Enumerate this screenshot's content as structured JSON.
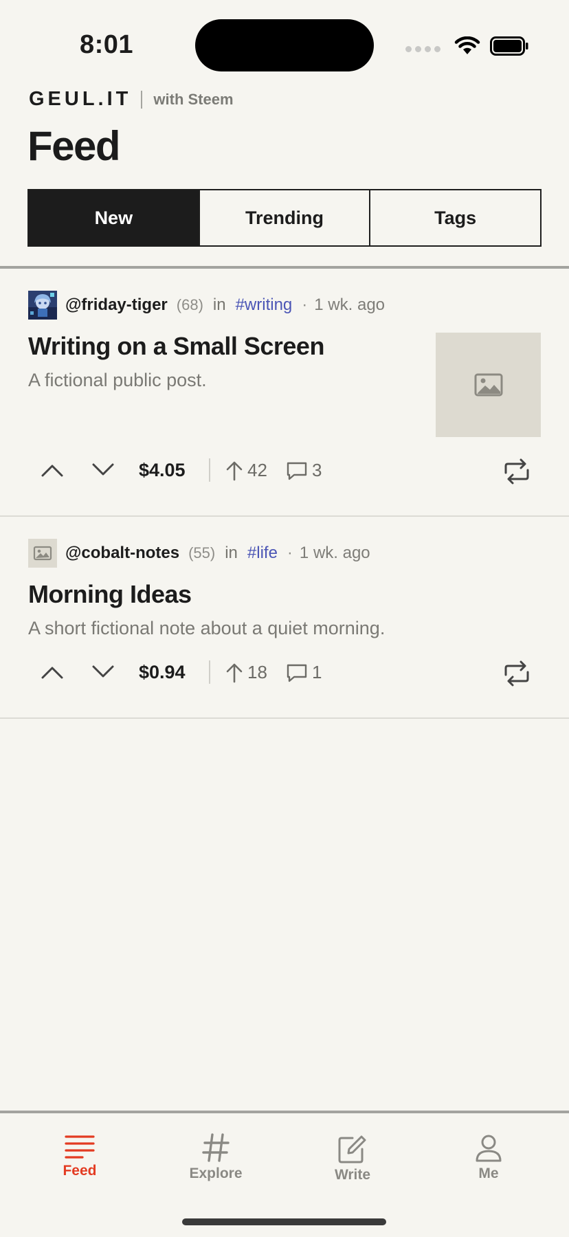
{
  "status_bar": {
    "time": "8:01"
  },
  "header": {
    "brand": "GEUL.IT",
    "brand_sub": "with Steem",
    "title": "Feed"
  },
  "tabs": [
    {
      "label": "New",
      "active": true
    },
    {
      "label": "Trending",
      "active": false
    },
    {
      "label": "Tags",
      "active": false
    }
  ],
  "posts": [
    {
      "author": "@friday-tiger",
      "reputation": "(68)",
      "in_label": "in",
      "tag": "#writing",
      "separator": "·",
      "time": "1 wk. ago",
      "title": "Writing on a Small Screen",
      "excerpt": "A fictional public post.",
      "payout": "$4.05",
      "votes": "42",
      "comments": "3",
      "avatar_icon": "anime-avatar-icon",
      "has_thumbnail": true
    },
    {
      "author": "@cobalt-notes",
      "reputation": "(55)",
      "in_label": "in",
      "tag": "#life",
      "separator": "·",
      "time": "1 wk. ago",
      "title": "Morning Ideas",
      "excerpt": "A short fictional note about a quiet morning.",
      "payout": "$0.94",
      "votes": "18",
      "comments": "1",
      "avatar_icon": "image-placeholder-icon",
      "has_thumbnail": false
    }
  ],
  "nav": [
    {
      "label": "Feed",
      "icon": "feed-lines-icon",
      "active": true
    },
    {
      "label": "Explore",
      "icon": "hash-icon",
      "active": false
    },
    {
      "label": "Write",
      "icon": "compose-icon",
      "active": false
    },
    {
      "label": "Me",
      "icon": "person-icon",
      "active": false
    }
  ],
  "colors": {
    "background": "#f6f5f0",
    "accent": "#e33b22",
    "tag": "#4b55b5",
    "active_tab": "#1c1c1c"
  }
}
